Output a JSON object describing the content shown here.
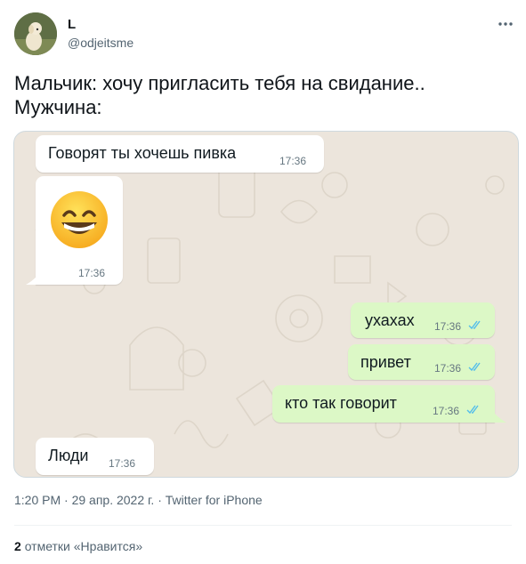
{
  "user": {
    "name": "L",
    "handle": "@odjeitsme"
  },
  "tweet": {
    "line1": "Мальчик: хочу пригласить тебя на свидание..",
    "line2": "Мужчина:"
  },
  "chat": {
    "messages": [
      {
        "dir": "in",
        "text": "Говорят ты хочешь пивка",
        "time": "17:36"
      },
      {
        "dir": "in",
        "emoji": "😁",
        "time": "17:36"
      },
      {
        "dir": "out",
        "text": "ухахах",
        "time": "17:36"
      },
      {
        "dir": "out",
        "text": "привет",
        "time": "17:36"
      },
      {
        "dir": "out",
        "text": "кто так говорит",
        "time": "17:36"
      },
      {
        "dir": "in",
        "text": "Люди",
        "time": "17:36"
      }
    ],
    "tick_color": "#53bdeb"
  },
  "meta": {
    "time": "1:20 PM",
    "date": "29 апр. 2022 г.",
    "source": "Twitter for iPhone",
    "sep": "·"
  },
  "likes": {
    "count": "2",
    "label": "отметки «Нравится»"
  },
  "icons": {
    "more": "more-dots-icon",
    "ticks": "double-check-icon"
  }
}
